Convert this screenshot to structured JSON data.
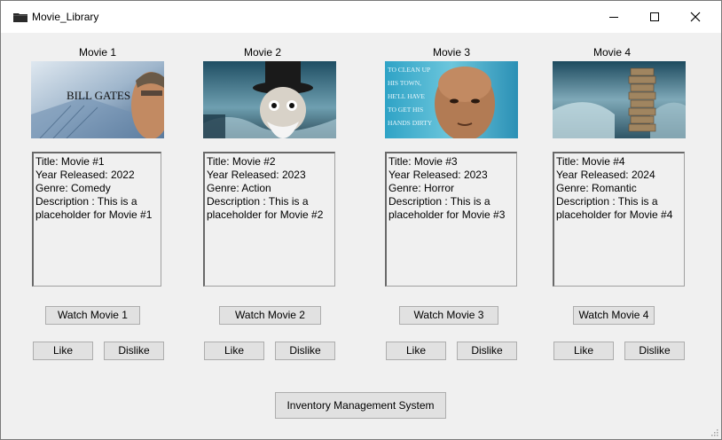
{
  "window": {
    "title": "Movie_Library",
    "icon": "folder-icon"
  },
  "movies": [
    {
      "label": "Movie 1",
      "poster_text": "BILL GATES",
      "lines": [
        "Title: Movie #1",
        "Year Released:  2022",
        "Genre: Comedy",
        "Description : This is a",
        "placeholder for Movie #1"
      ],
      "watch": "Watch Movie 1",
      "like": "Like",
      "dislike": "Dislike"
    },
    {
      "label": "Movie 2",
      "lines": [
        "Title: Movie #2",
        "Year Released:  2023",
        "Genre: Action",
        "Description : This is a",
        "placeholder for Movie #2"
      ],
      "watch": "Watch Movie 2",
      "like": "Like",
      "dislike": "Dislike"
    },
    {
      "label": "Movie 3",
      "poster_text": [
        "TO CLEAN UP",
        "HIS TOWN,",
        "HE'LL HAVE",
        "TO GET HIS",
        "HANDS DIRTY"
      ],
      "lines": [
        "Title: Movie #3",
        "Year Released:  2023",
        "Genre: Horror",
        "Description : This is a",
        "placeholder for Movie #3"
      ],
      "watch": "Watch Movie 3",
      "like": "Like",
      "dislike": "Dislike"
    },
    {
      "label": "Movie 4",
      "lines": [
        "Title: Movie #4",
        "Year Released:  2024",
        "Genre: Romantic",
        "Description : This is a",
        "placeholder for Movie #4"
      ],
      "watch": "Watch Movie 4",
      "like": "Like",
      "dislike": "Dislike"
    }
  ],
  "footer": {
    "inventory_button": "Inventory Management System"
  }
}
